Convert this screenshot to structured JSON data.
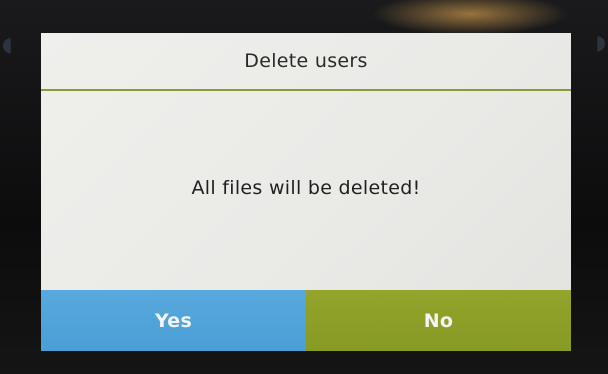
{
  "dialog": {
    "title": "Delete users",
    "message": "All files will be deleted!"
  },
  "buttons": {
    "yes_label": "Yes",
    "no_label": "No"
  },
  "colors": {
    "yes_button": "#4fa3d9",
    "no_button": "#8c9e27",
    "divider": "#8a9a3a",
    "screen_background": "#ecece9"
  }
}
